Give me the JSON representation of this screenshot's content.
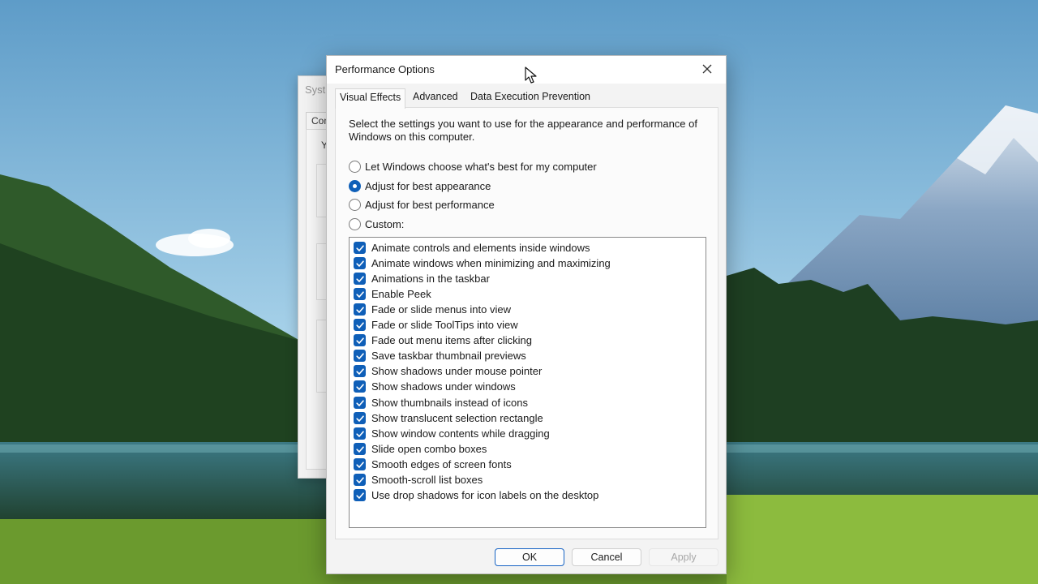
{
  "background_window": {
    "title": "Syst",
    "tab_label": "Con",
    "text": "Y"
  },
  "dialog": {
    "title": "Performance Options",
    "tabs": [
      {
        "label": "Visual Effects",
        "active": true
      },
      {
        "label": "Advanced",
        "active": false
      },
      {
        "label": "Data Execution Prevention",
        "active": false
      }
    ],
    "description": "Select the settings you want to use for the appearance and performance of Windows on this computer.",
    "radio_options": [
      {
        "label": "Let Windows choose what's best for my computer",
        "checked": false
      },
      {
        "label": "Adjust for best appearance",
        "checked": true
      },
      {
        "label": "Adjust for best performance",
        "checked": false
      },
      {
        "label": "Custom:",
        "checked": false
      }
    ],
    "effects": [
      {
        "label": "Animate controls and elements inside windows",
        "checked": true
      },
      {
        "label": "Animate windows when minimizing and maximizing",
        "checked": true
      },
      {
        "label": "Animations in the taskbar",
        "checked": true
      },
      {
        "label": "Enable Peek",
        "checked": true
      },
      {
        "label": "Fade or slide menus into view",
        "checked": true
      },
      {
        "label": "Fade or slide ToolTips into view",
        "checked": true
      },
      {
        "label": "Fade out menu items after clicking",
        "checked": true
      },
      {
        "label": "Save taskbar thumbnail previews",
        "checked": true
      },
      {
        "label": "Show shadows under mouse pointer",
        "checked": true
      },
      {
        "label": "Show shadows under windows",
        "checked": true
      },
      {
        "label": "Show thumbnails instead of icons",
        "checked": true
      },
      {
        "label": "Show translucent selection rectangle",
        "checked": true
      },
      {
        "label": "Show window contents while dragging",
        "checked": true
      },
      {
        "label": "Slide open combo boxes",
        "checked": true
      },
      {
        "label": "Smooth edges of screen fonts",
        "checked": true
      },
      {
        "label": "Smooth-scroll list boxes",
        "checked": true
      },
      {
        "label": "Use drop shadows for icon labels on the desktop",
        "checked": true
      }
    ],
    "buttons": {
      "ok": "OK",
      "cancel": "Cancel",
      "apply": "Apply"
    }
  },
  "colors": {
    "accent": "#0f5fb8",
    "dialog_bg": "#f3f3f3",
    "panel_bg": "#fbfbfb"
  }
}
